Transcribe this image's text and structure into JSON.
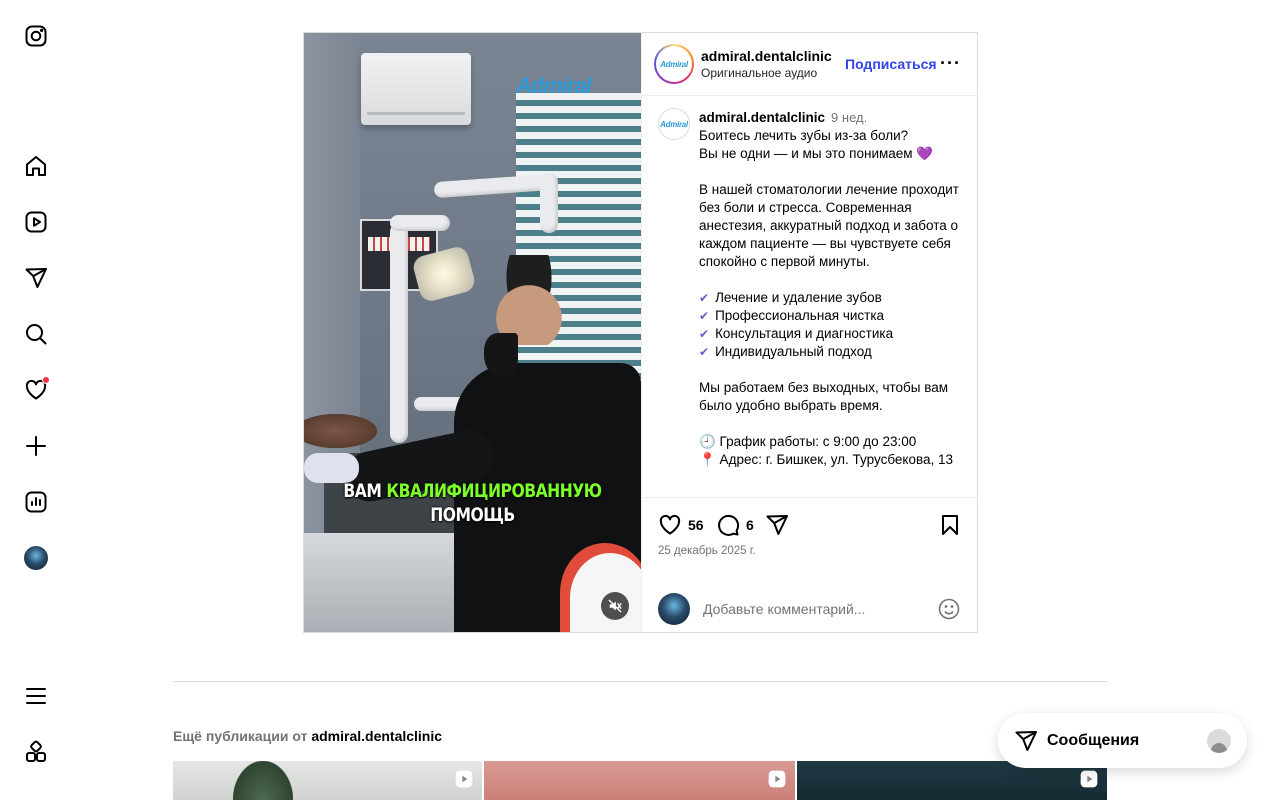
{
  "nav": {
    "items": [
      "instagram-logo",
      "home",
      "reels",
      "messages",
      "search",
      "notifications",
      "create",
      "dashboard",
      "profile",
      "menu",
      "also-from-meta"
    ]
  },
  "post": {
    "username": "admiral.dentalclinic",
    "audio": "Оригинальное аудио",
    "follow_label": "Подписаться",
    "more_label": "···",
    "logo_text": "Admiral",
    "video_caption_white1": "ВАМ ",
    "video_caption_green": "КВАЛИФИЦИРОВАННУЮ",
    "video_caption_white2": "ПОМОЩЬ",
    "caption_author": "admiral.dentalclinic",
    "caption_time": "9 нед.",
    "caption_p1": "Боитесь лечить зубы из-за боли?\nВы не одни — и мы это понимаем 💜",
    "caption_p2": "В нашей стоматологии лечение проходит без боли и стресса. Современная анестезия, аккуратный подход и забота о каждом пациенте — вы чувствуете себя спокойно с первой минуты.",
    "services": [
      "Лечение и удаление зубов",
      "Профессиональная чистка",
      "Консультация и диагностика",
      "Индивидуальный подход"
    ],
    "caption_p3": "Мы работаем без выходных, чтобы вам было удобно выбрать время.",
    "schedule": "🕘 График работы: с 9:00 до 23:00",
    "address": "📍 Адрес: г. Бишкек, ул. Турусбекова, 13",
    "likes": "56",
    "comments": "6",
    "date": "25 декабрь 2025 г.",
    "comment_placeholder": "Добавьте комментарий..."
  },
  "more_posts": {
    "prefix": "Ещё публикации от ",
    "author": "admiral.dentalclinic"
  },
  "messages": {
    "label": "Сообщения"
  },
  "colors": {
    "follow_blue": "#3143e8",
    "notification_red": "#ff3040",
    "caption_green": "#7dff2a"
  }
}
